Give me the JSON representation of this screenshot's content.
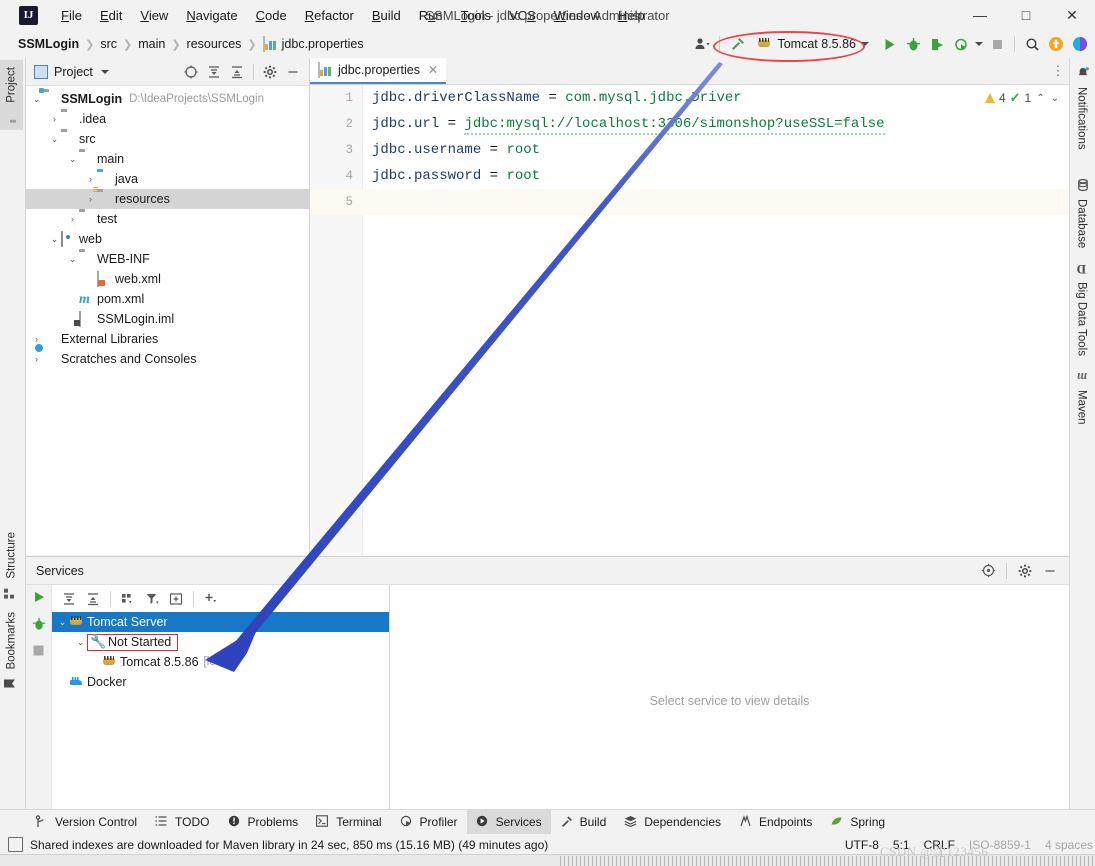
{
  "window": {
    "title": "SSMLogin - jdbc.properties - Administrator",
    "logo": "IJ",
    "minimize": "—",
    "maximize": "□",
    "close": "✕"
  },
  "menu": [
    {
      "label": "File"
    },
    {
      "label": "Edit"
    },
    {
      "label": "View"
    },
    {
      "label": "Navigate"
    },
    {
      "label": "Code"
    },
    {
      "label": "Refactor"
    },
    {
      "label": "Build"
    },
    {
      "label": "Run"
    },
    {
      "label": "Tools"
    },
    {
      "label": "VCS"
    },
    {
      "label": "Window"
    },
    {
      "label": "Help"
    }
  ],
  "breadcrumbs": [
    {
      "label": "SSMLogin"
    },
    {
      "label": "src"
    },
    {
      "label": "main"
    },
    {
      "label": "resources"
    },
    {
      "label": "jdbc.properties"
    }
  ],
  "toolbar": {
    "run_config": "Tomcat 8.5.86",
    "icons": [
      "settings-sync-icon",
      "hammer-build-icon",
      "run-icon",
      "debug-icon",
      "run-coverage-icon",
      "profile-icon",
      "stop-icon",
      "search-everywhere-icon",
      "updates-icon",
      "ide-assistant-icon"
    ]
  },
  "left_rail": [
    {
      "label": "Project",
      "active": true
    },
    {
      "label": "Structure",
      "active": false
    },
    {
      "label": "Bookmarks",
      "active": false
    }
  ],
  "right_rail": [
    {
      "label": "Notifications"
    },
    {
      "label": "Database"
    },
    {
      "label": "Big Data Tools"
    },
    {
      "label": "Maven"
    }
  ],
  "project_panel": {
    "title": "Project",
    "tree": [
      {
        "indent": 0,
        "arrow": "⌄",
        "icon": "module-icon",
        "label": "SSMLogin",
        "bold": true,
        "dim": "D:\\IdeaProjects\\SSMLogin",
        "selected": false
      },
      {
        "indent": 1,
        "arrow": "›",
        "icon": "folder-icon",
        "label": ".idea",
        "bold": false,
        "dim": "",
        "selected": false
      },
      {
        "indent": 1,
        "arrow": "⌄",
        "icon": "folder-icon",
        "label": "src",
        "bold": false,
        "dim": "",
        "selected": false
      },
      {
        "indent": 2,
        "arrow": "⌄",
        "icon": "folder-icon",
        "label": "main",
        "bold": false,
        "dim": "",
        "selected": false
      },
      {
        "indent": 3,
        "arrow": "›",
        "icon": "source-folder-icon",
        "label": "java",
        "bold": false,
        "dim": "",
        "selected": false
      },
      {
        "indent": 3,
        "arrow": "›",
        "icon": "resource-folder-icon",
        "label": "resources",
        "bold": false,
        "dim": "",
        "selected": true
      },
      {
        "indent": 2,
        "arrow": "›",
        "icon": "folder-icon",
        "label": "test",
        "bold": false,
        "dim": "",
        "selected": false
      },
      {
        "indent": 1,
        "arrow": "⌄",
        "icon": "web-module-icon",
        "label": "web",
        "bold": false,
        "dim": "",
        "selected": false
      },
      {
        "indent": 2,
        "arrow": "⌄",
        "icon": "folder-icon",
        "label": "WEB-INF",
        "bold": false,
        "dim": "",
        "selected": false
      },
      {
        "indent": 3,
        "arrow": "",
        "icon": "xml-file-icon",
        "label": "web.xml",
        "bold": false,
        "dim": "",
        "selected": false
      },
      {
        "indent": 1,
        "arrow": "",
        "icon": "maven-pom-icon",
        "label": "pom.xml",
        "bold": false,
        "dim": "",
        "selected": false
      },
      {
        "indent": 1,
        "arrow": "",
        "icon": "iml-file-icon",
        "label": "SSMLogin.iml",
        "bold": false,
        "dim": "",
        "selected": false
      },
      {
        "indent": 0,
        "arrow": "›",
        "icon": "external-libraries-icon",
        "label": "External Libraries",
        "bold": false,
        "dim": "",
        "selected": false
      },
      {
        "indent": 0,
        "arrow": "›",
        "icon": "scratches-icon",
        "label": "Scratches and Consoles",
        "bold": false,
        "dim": "",
        "selected": false
      }
    ]
  },
  "editor": {
    "tab": {
      "label": "jdbc.properties",
      "close": "✕"
    },
    "more": "⋮",
    "inspection": {
      "warnings": "4",
      "checks": "1",
      "up": "⌃",
      "down": "⌄"
    },
    "lines": [
      {
        "num": "1",
        "key": "jdbc.driverClassName",
        "eq": " = ",
        "value": "com.mysql.jdbc.Driver",
        "squiggle": false,
        "current": false
      },
      {
        "num": "2",
        "key": "jdbc.url",
        "eq": " = ",
        "value": "jdbc:mysql://localhost:3306/simonshop?useSSL=false",
        "squiggle": true,
        "current": false
      },
      {
        "num": "3",
        "key": "jdbc.username",
        "eq": " = ",
        "value": "root",
        "squiggle": false,
        "current": false
      },
      {
        "num": "4",
        "key": "jdbc.password",
        "eq": " = ",
        "value": "root",
        "squiggle": false,
        "current": false
      },
      {
        "num": "5",
        "key": "",
        "eq": "",
        "value": "",
        "squiggle": false,
        "current": true
      }
    ]
  },
  "services": {
    "title": "Services",
    "empty_message": "Select service to view details",
    "tree": [
      {
        "indent": 0,
        "arrow": "⌄",
        "icon": "tomcat-icon",
        "label": "Tomcat Server",
        "suffix": "",
        "selected": true,
        "boxed": false
      },
      {
        "indent": 1,
        "arrow": "⌄",
        "icon": "wrench-icon",
        "label": "Not Started",
        "suffix": "",
        "selected": false,
        "boxed": true
      },
      {
        "indent": 2,
        "arrow": "",
        "icon": "tomcat-icon",
        "label": "Tomcat 8.5.86",
        "suffix": "[local]",
        "selected": false,
        "boxed": false
      },
      {
        "indent": 0,
        "arrow": "",
        "icon": "docker-icon",
        "label": "Docker",
        "suffix": "",
        "selected": false,
        "boxed": false
      }
    ]
  },
  "bottom_bar": [
    {
      "label": "Version Control",
      "icon": "branch-icon",
      "active": false
    },
    {
      "label": "TODO",
      "icon": "list-icon",
      "active": false
    },
    {
      "label": "Problems",
      "icon": "exclamation-icon",
      "active": false
    },
    {
      "label": "Terminal",
      "icon": "terminal-icon",
      "active": false
    },
    {
      "label": "Profiler",
      "icon": "profiler-icon",
      "active": false
    },
    {
      "label": "Services",
      "icon": "services-icon",
      "active": true
    },
    {
      "label": "Build",
      "icon": "hammer-icon",
      "active": false
    },
    {
      "label": "Dependencies",
      "icon": "layers-icon",
      "active": false
    },
    {
      "label": "Endpoints",
      "icon": "endpoints-icon",
      "active": false
    },
    {
      "label": "Spring",
      "icon": "spring-leaf-icon",
      "active": false
    }
  ],
  "status_bar": {
    "message": "Shared indexes are downloaded for Maven library in 24 sec, 850 ms (15.16 MB) (49 minutes ago)",
    "encoding": "UTF-8",
    "caret": "5:1",
    "line_separator": "CRLF",
    "file_encoding": "ISO-8859-1",
    "indent": "4 spaces"
  },
  "watermark": "CSDN @沈123456",
  "colors": {
    "accent_blue": "#1878c8",
    "annotation_red": "#e02b2b",
    "arrow_blue": "#3355cc",
    "value_green": "#0a7d3c",
    "key_navy": "#1d3b6e"
  }
}
